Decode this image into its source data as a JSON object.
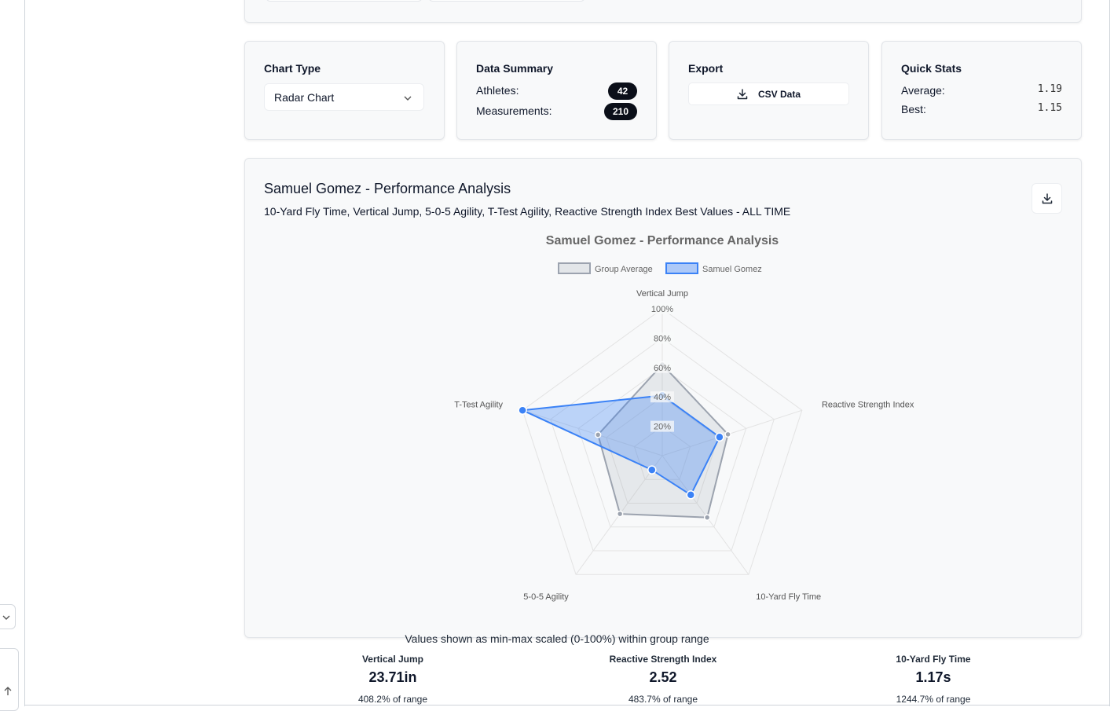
{
  "controls": {
    "chart_type": {
      "title": "Chart Type",
      "value": "Radar Chart"
    },
    "data_summary": {
      "title": "Data Summary",
      "athletes_label": "Athletes:",
      "athletes": "42",
      "measurements_label": "Measurements:",
      "measurements": "210"
    },
    "export": {
      "title": "Export",
      "button_label": "CSV Data"
    },
    "quick_stats": {
      "title": "Quick Stats",
      "average_label": "Average:",
      "average": "1.19",
      "best_label": "Best:",
      "best": "1.15"
    }
  },
  "analysis": {
    "title": "Samuel Gomez - Performance Analysis",
    "subtitle": "10-Yard Fly Time, Vertical Jump, 5-0-5 Agility, T-Test Agility, Reactive Strength Index Best Values - ALL TIME",
    "footnote": "Values shown as min-max scaled (0-100%) within group range"
  },
  "chart_data": {
    "type": "radar",
    "title": "Samuel Gomez - Performance Analysis",
    "axes": [
      "Vertical Jump",
      "Reactive Strength Index",
      "10-Yard Fly Time",
      "5-0-5 Agility",
      "T-Test Agility"
    ],
    "range": [
      0,
      100
    ],
    "ticks": [
      "20%",
      "40%",
      "60%",
      "80%",
      "100%"
    ],
    "tick_values": [
      20,
      40,
      60,
      80,
      100
    ],
    "legend_position": "top",
    "series": [
      {
        "name": "Group Average",
        "values": [
          62,
          47,
          52,
          49,
          46
        ],
        "color": "#9ca3af"
      },
      {
        "name": "Samuel Gomez",
        "values": [
          41,
          41,
          33,
          12,
          100
        ],
        "color": "#3b82f6"
      }
    ]
  },
  "metrics": [
    {
      "name": "Vertical Jump",
      "value": "23.71in",
      "range": "408.2% of range"
    },
    {
      "name": "Reactive Strength Index",
      "value": "2.52",
      "range": "483.7% of range"
    },
    {
      "name": "10-Yard Fly Time",
      "value": "1.17s",
      "range": "1244.7% of range"
    }
  ]
}
